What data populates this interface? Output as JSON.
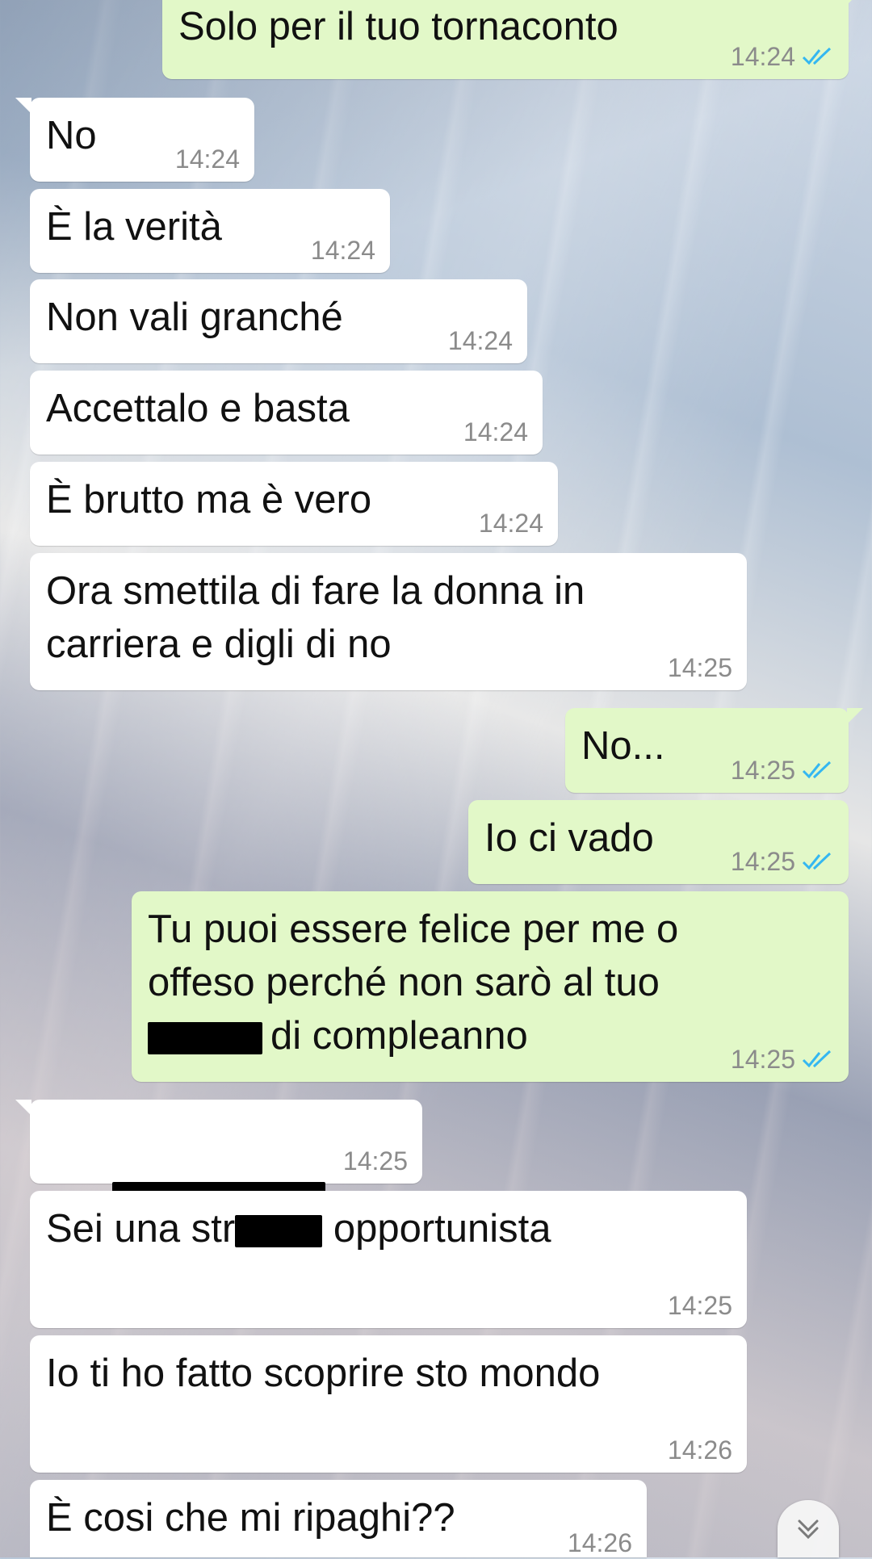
{
  "accent_colors": {
    "incoming_bubble": "#ffffff",
    "outgoing_bubble": "#e2f8c8",
    "read_ticks": "#34b7f1",
    "timestamp": "#8b8b8b"
  },
  "messages": [
    {
      "direction": "outgoing",
      "text": "Solo per il tuo tornaconto",
      "time": "14:24",
      "status": "read"
    },
    {
      "direction": "incoming",
      "text": "No",
      "time": "14:24"
    },
    {
      "direction": "incoming",
      "text": "È la verità",
      "time": "14:24"
    },
    {
      "direction": "incoming",
      "text": "Non vali granché",
      "time": "14:24"
    },
    {
      "direction": "incoming",
      "text": "Accettalo e basta",
      "time": "14:24"
    },
    {
      "direction": "incoming",
      "text": "È brutto ma è vero",
      "time": "14:24"
    },
    {
      "direction": "incoming",
      "text": "Ora smettila di fare la donna in\ncarriera e digli di no",
      "time": "14:25"
    },
    {
      "direction": "outgoing",
      "text": "No...",
      "time": "14:25",
      "status": "read"
    },
    {
      "direction": "outgoing",
      "text": "Io ci vado",
      "time": "14:25",
      "status": "read"
    },
    {
      "direction": "outgoing",
      "text_lines": [
        "Tu puoi essere felice per me o",
        "offeso perché non sarò al tuo",
        "di compleanno"
      ],
      "time": "14:25",
      "status": "read",
      "redacted": true
    },
    {
      "direction": "incoming",
      "text": "",
      "time": "14:25",
      "redacted": true
    },
    {
      "direction": "incoming",
      "text_before": "Sei una str",
      "text_after": " opportunista",
      "time": "14:25",
      "redacted": true
    },
    {
      "direction": "incoming",
      "text": "Io ti ho fatto scoprire sto mondo",
      "time": "14:26"
    },
    {
      "direction": "incoming",
      "text": "È cosi che mi ripaghi??",
      "time": "14:26"
    }
  ],
  "scroll_button": {
    "icon": "double-chevron-down-icon"
  }
}
